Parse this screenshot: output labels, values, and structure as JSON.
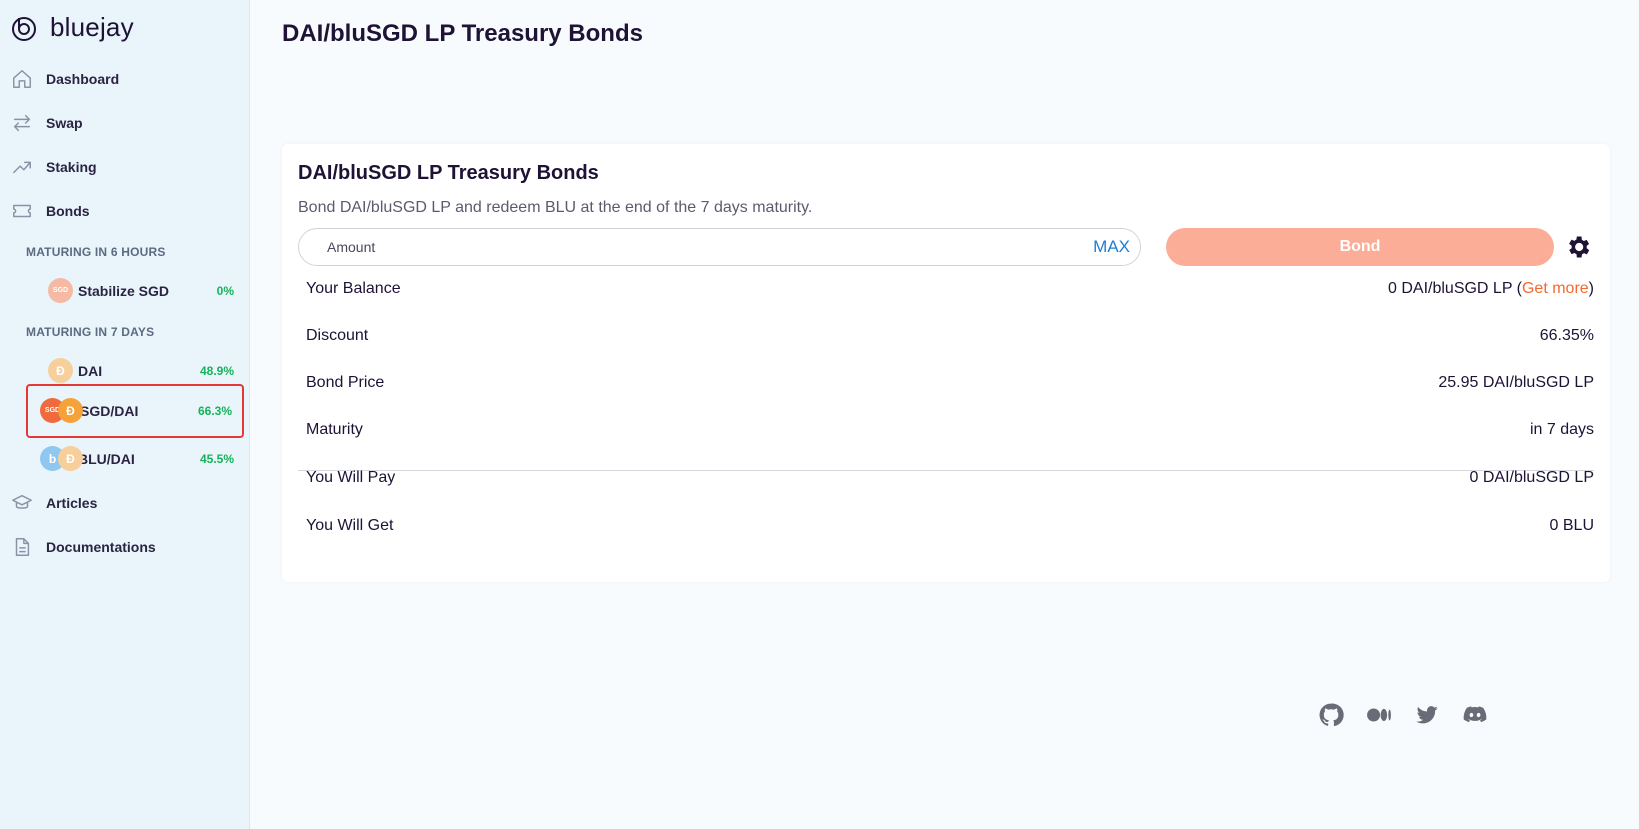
{
  "app": {
    "logo_text": "bluejay"
  },
  "sidebar": {
    "nav": [
      {
        "label": "Dashboard",
        "icon": "home-icon"
      },
      {
        "label": "Swap",
        "icon": "swap-icon"
      },
      {
        "label": "Staking",
        "icon": "trending-up-icon"
      },
      {
        "label": "Bonds",
        "icon": "ticket-icon"
      },
      {
        "label": "Articles",
        "icon": "graduation-cap-icon"
      },
      {
        "label": "Documentations",
        "icon": "document-icon"
      }
    ],
    "section_6h": "MATURING IN 6 HOURS",
    "section_7d": "MATURING IN 7 DAYS",
    "bonds": [
      {
        "name": "Stabilize SGD",
        "pct": "0%",
        "coins": [
          "SGD"
        ]
      },
      {
        "name": "DAI",
        "pct": "48.9%",
        "coins": [
          "DAI"
        ]
      },
      {
        "name": "SGD/DAI",
        "pct": "66.3%",
        "coins": [
          "SGD",
          "DAI"
        ],
        "active": true
      },
      {
        "name": "BLU/DAI",
        "pct": "45.5%",
        "coins": [
          "BLU",
          "DAI"
        ]
      }
    ]
  },
  "main": {
    "page_title": "DAI/bluSGD LP Treasury Bonds",
    "card": {
      "title": "DAI/bluSGD LP Treasury Bonds",
      "description": "Bond DAI/bluSGD LP and redeem BLU at the end of the 7 days maturity.",
      "amount_placeholder": "Amount",
      "max_label": "MAX",
      "bond_label": "Bond",
      "balance": {
        "label": "Your Balance",
        "value": "0 DAI/bluSGD LP (",
        "get_more": "Get more",
        "close": ")"
      },
      "rows": [
        {
          "label": "Discount",
          "value": "66.35%"
        },
        {
          "label": "Bond Price",
          "value": "25.95 DAI/bluSGD LP"
        },
        {
          "label": "Maturity",
          "value": "in 7 days"
        }
      ],
      "result_rows": [
        {
          "label": "You Will Pay",
          "value": "0 DAI/bluSGD LP"
        },
        {
          "label": "You Will Get",
          "value": "0 BLU"
        }
      ]
    }
  },
  "footer": {
    "socials": [
      "github-icon",
      "medium-icon",
      "twitter-icon",
      "discord-icon"
    ]
  },
  "colors": {
    "accent_orange": "#f3692f",
    "bond_button": "#fcad98",
    "positive": "#16b35a",
    "max_blue": "#1a7fd8",
    "active_border": "#e53935"
  }
}
